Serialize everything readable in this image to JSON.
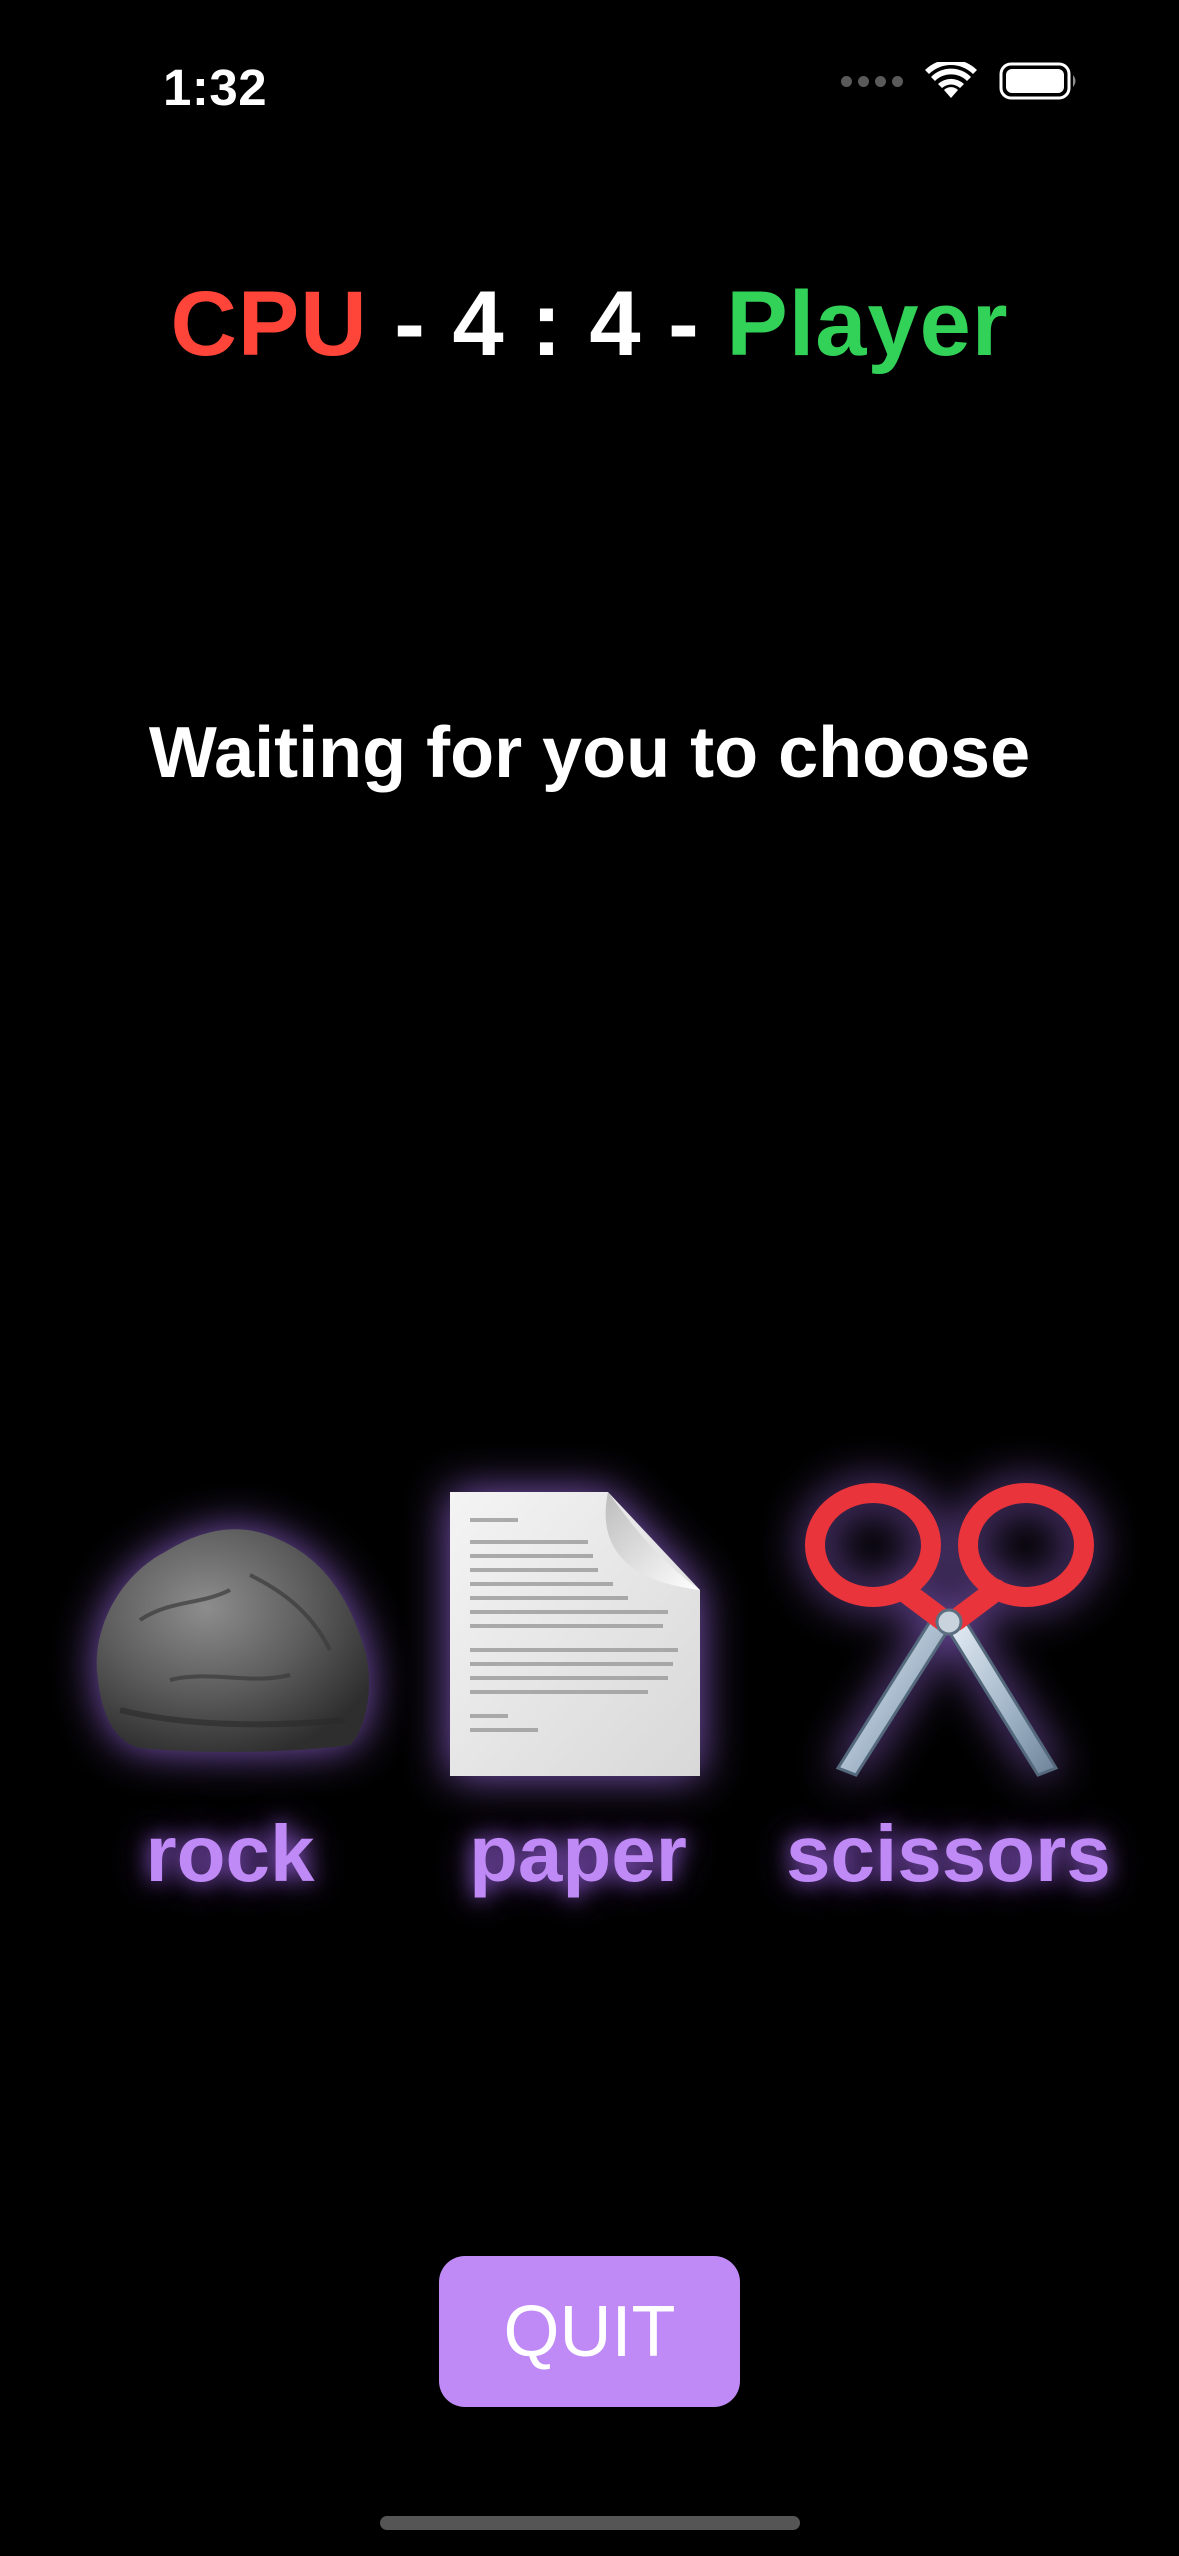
{
  "status_bar": {
    "time": "1:32"
  },
  "score": {
    "cpu_label": "CPU",
    "separator_left": " - ",
    "cpu_score": "4",
    "colon": " : ",
    "player_score": "4",
    "separator_right": " - ",
    "player_label": "Player",
    "cpu_color": "#ff453a",
    "player_color": "#32d158"
  },
  "prompt": "Waiting for you to choose",
  "choices": [
    {
      "label": "rock",
      "icon": "rock-icon"
    },
    {
      "label": "paper",
      "icon": "paper-icon"
    },
    {
      "label": "scissors",
      "icon": "scissors-icon"
    }
  ],
  "accent_color": "#bf8af5",
  "quit_label": "QUIT"
}
